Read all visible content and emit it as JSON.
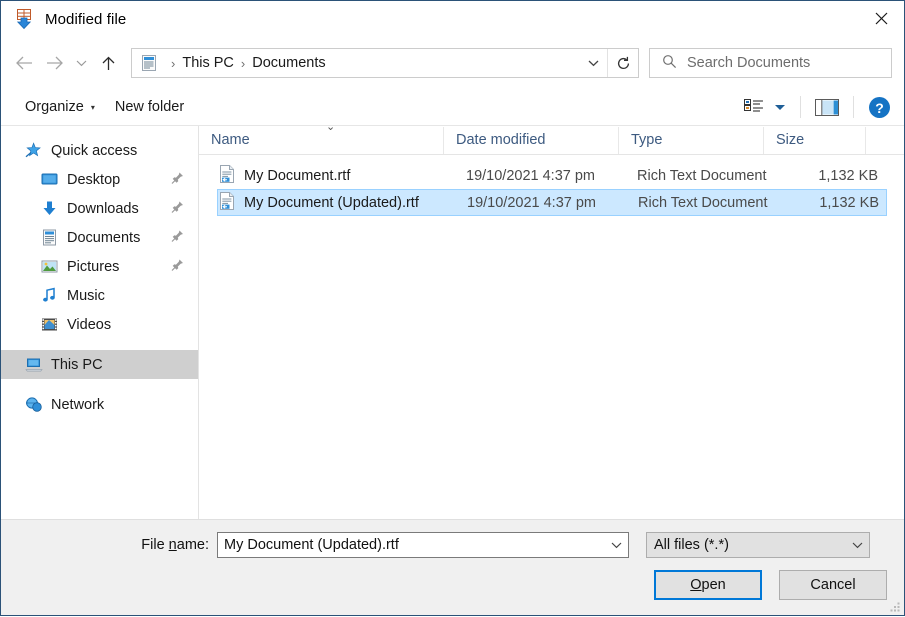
{
  "window": {
    "title": "Modified file",
    "title_icon": "save-download-icon",
    "close_label": "✕"
  },
  "nav": {
    "back_icon": "arrow-left-icon",
    "forward_icon": "arrow-right-icon",
    "recent_icon": "chevron-down-icon",
    "up_icon": "arrow-up-icon",
    "breadcrumb_icon": "documents-folder-icon",
    "breadcrumb": [
      {
        "label": "This PC"
      },
      {
        "label": "Documents"
      }
    ],
    "breadcrumb_separator": "›",
    "breadcrumb_dropdown_icon": "chevron-down-icon",
    "refresh_icon": "refresh-icon"
  },
  "search": {
    "icon": "search-icon",
    "placeholder": "Search Documents",
    "value": ""
  },
  "toolbar": {
    "organize_label": "Organize",
    "organize_caret": "▾",
    "new_folder_label": "New folder",
    "view_icon": "view-options-icon",
    "view_caret_icon": "chevron-down-icon",
    "preview_pane_icon": "preview-pane-icon",
    "help_icon": "help-icon",
    "help_glyph": "?"
  },
  "sidebar": {
    "items": [
      {
        "label": "Quick access",
        "icon": "quick-access-star-icon",
        "indent": false,
        "pinned": false,
        "selected": false
      },
      {
        "label": "Desktop",
        "icon": "desktop-icon",
        "indent": true,
        "pinned": true,
        "selected": false
      },
      {
        "label": "Downloads",
        "icon": "downloads-icon",
        "indent": true,
        "pinned": true,
        "selected": false
      },
      {
        "label": "Documents",
        "icon": "documents-icon",
        "indent": true,
        "pinned": true,
        "selected": false
      },
      {
        "label": "Pictures",
        "icon": "pictures-icon",
        "indent": true,
        "pinned": true,
        "selected": false
      },
      {
        "label": "Music",
        "icon": "music-icon",
        "indent": true,
        "pinned": false,
        "selected": false
      },
      {
        "label": "Videos",
        "icon": "videos-icon",
        "indent": true,
        "pinned": false,
        "selected": false
      },
      {
        "label": "This PC",
        "icon": "this-pc-icon",
        "indent": false,
        "pinned": false,
        "selected": true
      },
      {
        "label": "Network",
        "icon": "network-icon",
        "indent": false,
        "pinned": false,
        "selected": false
      }
    ]
  },
  "file_list": {
    "columns": [
      {
        "key": "name",
        "label": "Name"
      },
      {
        "key": "date",
        "label": "Date modified"
      },
      {
        "key": "type",
        "label": "Type"
      },
      {
        "key": "size",
        "label": "Size"
      }
    ],
    "sort_indicator": "⌄",
    "rows": [
      {
        "name": "My Document.rtf",
        "date": "19/10/2021 4:37 pm",
        "type": "Rich Text Document",
        "size": "1,132 KB",
        "icon": "rtf-file-icon",
        "selected": false
      },
      {
        "name": "My Document (Updated).rtf",
        "date": "19/10/2021 4:37 pm",
        "type": "Rich Text Document",
        "size": "1,132 KB",
        "icon": "rtf-file-icon",
        "selected": true
      }
    ]
  },
  "footer": {
    "file_name_label_pre": "File ",
    "file_name_label_accel": "n",
    "file_name_label_post": "ame:",
    "file_name_value": "My Document (Updated).rtf",
    "file_name_caret": "⌄",
    "file_type_value": "All files (*.*)",
    "file_type_caret": "⌄",
    "open_label_accel": "O",
    "open_label_post": "pen",
    "cancel_label": "Cancel",
    "resize_grip_icon": "resize-grip-icon"
  },
  "colors": {
    "accent": "#0078d7",
    "selection": "#cce8ff",
    "sidebar_selection": "#cfcfcf",
    "window_border": "#2b5278",
    "footer_bg": "#f0f0f0",
    "column_header_text": "#3d5a80"
  }
}
